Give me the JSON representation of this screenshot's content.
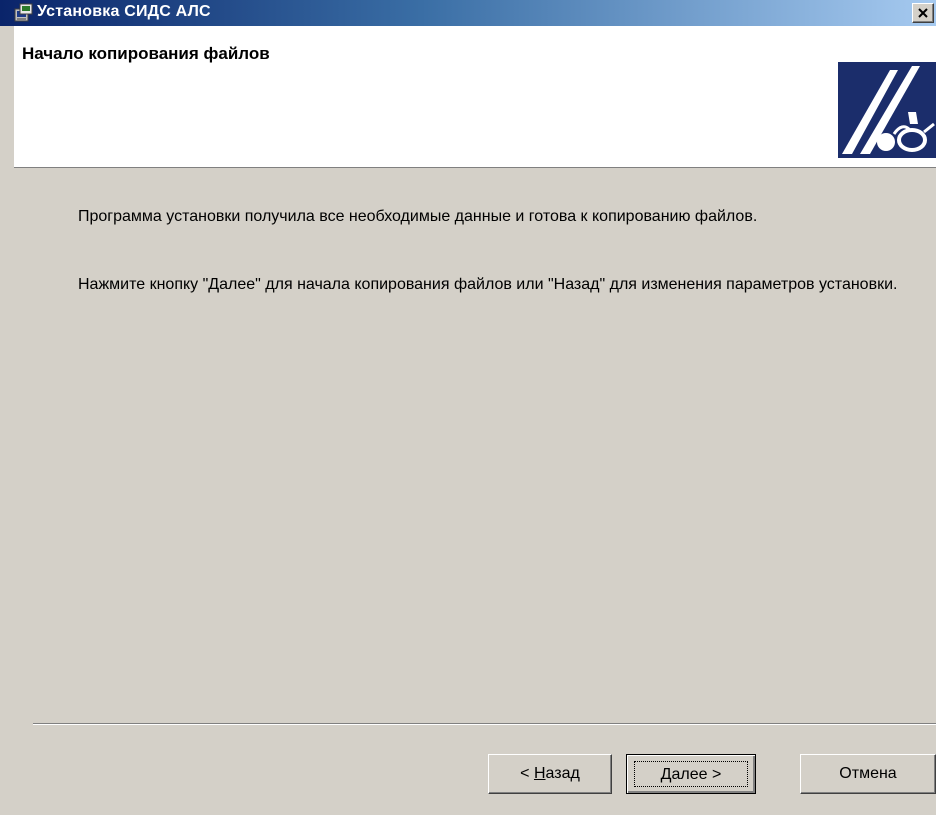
{
  "window": {
    "title": "Установка СИДС АЛС",
    "app_icon": "installer-icon",
    "close_icon": "close-icon"
  },
  "banner": {
    "heading": "Начало копирования файлов",
    "logo": "als-logo"
  },
  "content": {
    "paragraph1": "Программа установки получила все необходимые данные и готова к копированию файлов.",
    "paragraph2": "Нажмите кнопку \"Далее\" для начала копирования файлов или \"Назад\" для изменения параметров установки."
  },
  "buttons": {
    "back": {
      "prefix": "< ",
      "mnemonic": "Н",
      "rest": "азад"
    },
    "next": {
      "mnemonic": "Д",
      "rest": "алее >"
    },
    "cancel": {
      "label": "Отмена"
    }
  },
  "colors": {
    "titlebar_start": "#0a246a",
    "titlebar_end": "#a6caf0",
    "dialog_bg": "#d4d0c8",
    "logo_blue": "#1b2d6b"
  }
}
